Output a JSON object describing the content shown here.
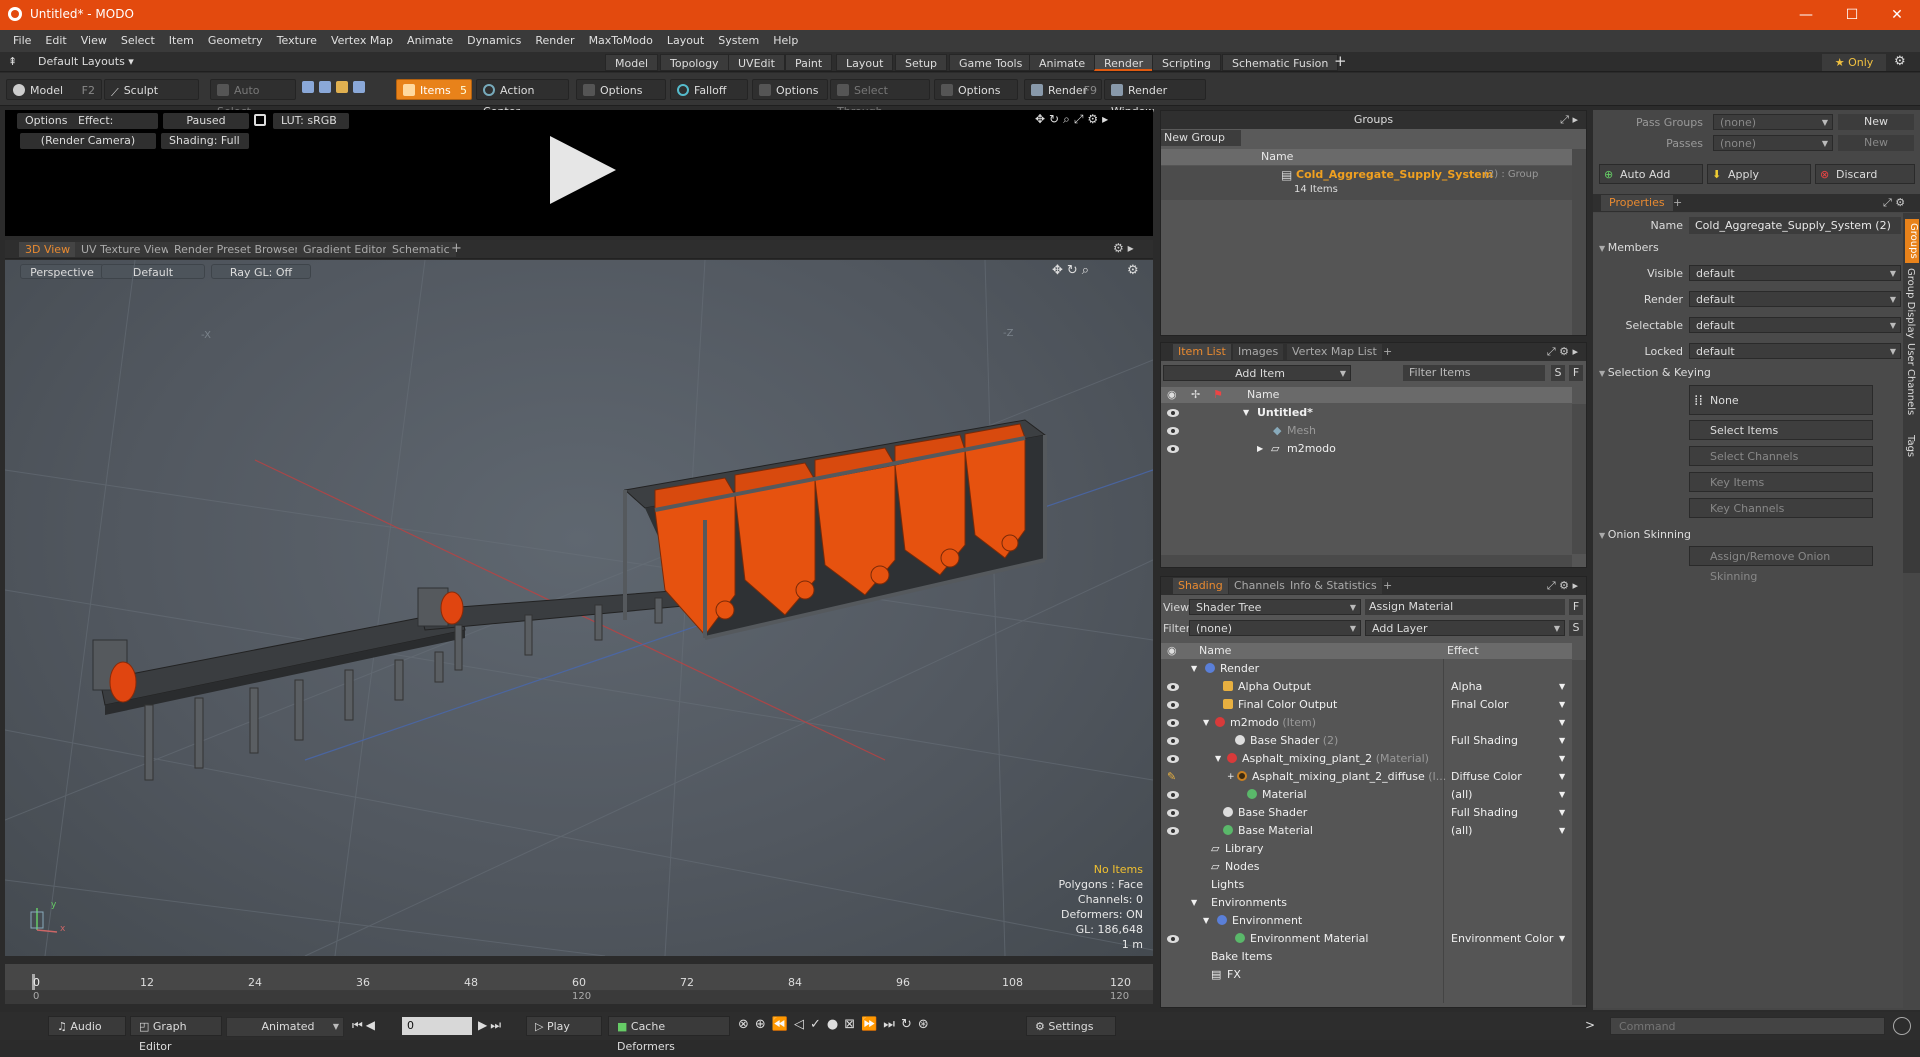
{
  "window": {
    "title": "Untitled* - MODO",
    "minimize": "—",
    "maximize": "☐",
    "close": "✕"
  },
  "menu": [
    "File",
    "Edit",
    "View",
    "Select",
    "Item",
    "Geometry",
    "Texture",
    "Vertex Map",
    "Animate",
    "Dynamics",
    "Render",
    "MaxToModo",
    "Layout",
    "System",
    "Help"
  ],
  "layoutbar": {
    "default_layouts": "Default Layouts ▾",
    "tabs": [
      "Model",
      "Topology",
      "UVEdit",
      "Paint",
      "Layout",
      "Setup",
      "Game Tools",
      "Animate",
      "Render",
      "Scripting",
      "Schematic Fusion"
    ],
    "active_tab": "Render",
    "add": "+",
    "only": "★ Only"
  },
  "toolbar": {
    "model": "Model",
    "model_key": "F2",
    "sculpt": "Sculpt",
    "auto_select": "Auto Select",
    "items": "Items",
    "items_key": "5",
    "action_center": "Action Center",
    "options1": "Options",
    "falloff": "Falloff",
    "options2": "Options",
    "select_through": "Select Through",
    "options3": "Options",
    "render": "Render",
    "render_key": "F9",
    "render_window": "Render Window"
  },
  "render_panel": {
    "options": "Options",
    "effect": "Effect: (Shadi...",
    "paused": "Paused",
    "lut": "LUT: sRGB",
    "camera": "(Render Camera)",
    "shading": "Shading: Full"
  },
  "viewport_tabs": [
    "3D View",
    "UV Texture View",
    "Render Preset Browser",
    "Gradient Editor",
    "Schematic"
  ],
  "viewport": {
    "perspective": "Perspective",
    "default": "Default",
    "raygl": "Ray GL: Off",
    "axis_x": "-X",
    "axis_z": "-Z",
    "gizmo_y": "y",
    "gizmo_x": "x",
    "info": {
      "no_items": "No Items",
      "polygons": "Polygons : Face",
      "channels": "Channels: 0",
      "deformers": "Deformers: ON",
      "gl": "GL: 186,648",
      "scale": "1 m"
    }
  },
  "timeline": {
    "ticks": [
      "0",
      "12",
      "24",
      "36",
      "48",
      "60",
      "72",
      "84",
      "96",
      "108",
      "120"
    ],
    "sub_left": "0",
    "sub_mid": "120",
    "sub_right": "120"
  },
  "bottombar": {
    "audio": "Audio",
    "graph_editor": "Graph Editor",
    "animated": "Animated",
    "frame": "0",
    "play": "Play",
    "cache_deformers": "Cache Deformers",
    "settings": "Settings"
  },
  "groups": {
    "title": "Groups",
    "new_group": "New Group",
    "col_name": "Name",
    "group_name": "Cold_Aggregate_Supply_System",
    "group_meta": "(2) : Group",
    "group_items": "14 Items"
  },
  "pass_groups": {
    "pass_groups_label": "Pass Groups",
    "pass_groups_value": "(none)",
    "new1": "New",
    "passes_label": "Passes",
    "passes_value": "(none)",
    "new2": "New"
  },
  "actions": {
    "auto_add": "Auto Add",
    "apply": "Apply",
    "discard": "Discard"
  },
  "properties": {
    "tab": "Properties",
    "name_label": "Name",
    "name_value": "Cold_Aggregate_Supply_System (2)",
    "members": "Members",
    "fields": [
      {
        "label": "Visible",
        "value": "default"
      },
      {
        "label": "Render",
        "value": "default"
      },
      {
        "label": "Selectable",
        "value": "default"
      },
      {
        "label": "Locked",
        "value": "default"
      }
    ],
    "selection_keying": "Selection & Keying",
    "none": "None",
    "select_items": "Select Items",
    "select_channels": "Select Channels",
    "key_items": "Key Items",
    "key_channels": "Key Channels",
    "onion": "Onion Skinning",
    "assign_onion": "Assign/Remove Onion Skinning",
    "side_tabs": [
      "Groups",
      "Group Display",
      "User Channels",
      "Tags"
    ]
  },
  "item_list": {
    "tabs": [
      "Item List",
      "Images",
      "Vertex Map List"
    ],
    "add_item": "Add Item",
    "filter": "Filter Items",
    "s": "S",
    "f": "F",
    "col_name": "Name",
    "rows": [
      {
        "name": "Untitled*",
        "indent": 0
      },
      {
        "name": "Mesh",
        "indent": 1
      },
      {
        "name": "m2modo",
        "indent": 1
      }
    ]
  },
  "shading": {
    "tabs": [
      "Shading",
      "Channels",
      "Info & Statistics"
    ],
    "view_label": "View",
    "view_value": "Shader Tree",
    "assign_material": "Assign Material",
    "filter_label": "Filter",
    "filter_value": "(none)",
    "add_layer": "Add Layer",
    "col_name": "Name",
    "col_effect": "Effect",
    "rows": [
      {
        "name": "Render",
        "sub": "",
        "effect": "",
        "indent": 0
      },
      {
        "name": "Alpha Output",
        "sub": "",
        "effect": "Alpha",
        "indent": 1
      },
      {
        "name": "Final Color Output",
        "sub": "",
        "effect": "Final Color",
        "indent": 1
      },
      {
        "name": "m2modo",
        "sub": "(Item)",
        "effect": "",
        "indent": 1
      },
      {
        "name": "Base Shader",
        "sub": "(2)",
        "effect": "Full Shading",
        "indent": 2
      },
      {
        "name": "Asphalt_mixing_plant_2",
        "sub": "(Material)",
        "effect": "",
        "indent": 2
      },
      {
        "name": "Asphalt_mixing_plant_2_diffuse",
        "sub": "(I...",
        "effect": "Diffuse Color",
        "indent": 3
      },
      {
        "name": "Material",
        "sub": "",
        "effect": "(all)",
        "indent": 3
      },
      {
        "name": "Base Shader",
        "sub": "",
        "effect": "Full Shading",
        "indent": 1
      },
      {
        "name": "Base Material",
        "sub": "",
        "effect": "(all)",
        "indent": 1
      },
      {
        "name": "Library",
        "sub": "",
        "effect": "",
        "indent": 0
      },
      {
        "name": "Nodes",
        "sub": "",
        "effect": "",
        "indent": 0
      },
      {
        "name": "Lights",
        "sub": "",
        "effect": "",
        "indent": -1
      },
      {
        "name": "Environments",
        "sub": "",
        "effect": "",
        "indent": -1
      },
      {
        "name": "Environment",
        "sub": "",
        "effect": "",
        "indent": 1
      },
      {
        "name": "Environment Material",
        "sub": "",
        "effect": "Environment Color",
        "indent": 2
      },
      {
        "name": "Bake Items",
        "sub": "",
        "effect": "",
        "indent": -1
      },
      {
        "name": "FX",
        "sub": "",
        "effect": "",
        "indent": 0
      }
    ]
  },
  "command": {
    "placeholder": "Command"
  },
  "colors": {
    "accent": "#e34a0e",
    "orange": "#e8821a",
    "group_name": "#f0a020"
  }
}
